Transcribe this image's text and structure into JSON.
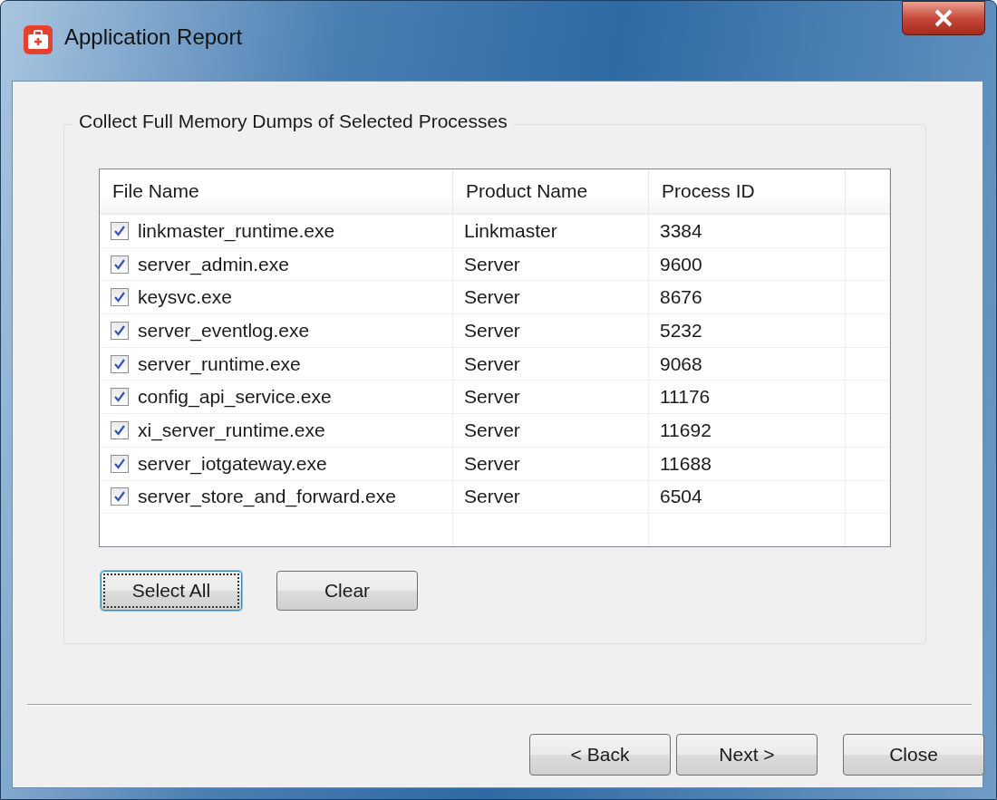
{
  "window": {
    "title": "Application Report"
  },
  "group": {
    "title": "Collect Full Memory Dumps of Selected Processes"
  },
  "table": {
    "columns": [
      "File Name",
      "Product Name",
      "Process ID"
    ],
    "rows": [
      {
        "checked": true,
        "file": "linkmaster_runtime.exe",
        "product": "Linkmaster",
        "pid": "3384"
      },
      {
        "checked": true,
        "file": "server_admin.exe",
        "product": "Server",
        "pid": "9600"
      },
      {
        "checked": true,
        "file": "keysvc.exe",
        "product": "Server",
        "pid": "8676"
      },
      {
        "checked": true,
        "file": "server_eventlog.exe",
        "product": "Server",
        "pid": "5232"
      },
      {
        "checked": true,
        "file": "server_runtime.exe",
        "product": "Server",
        "pid": "9068"
      },
      {
        "checked": true,
        "file": "config_api_service.exe",
        "product": "Server",
        "pid": "11176"
      },
      {
        "checked": true,
        "file": "xi_server_runtime.exe",
        "product": "Server",
        "pid": "11692"
      },
      {
        "checked": true,
        "file": "server_iotgateway.exe",
        "product": "Server",
        "pid": "11688"
      },
      {
        "checked": true,
        "file": "server_store_and_forward.exe",
        "product": "Server",
        "pid": "6504"
      }
    ]
  },
  "selection_buttons": [
    {
      "label": "Select All",
      "focused": true
    },
    {
      "label": "Clear",
      "focused": false
    }
  ],
  "footer_buttons": [
    {
      "label": "< Back"
    },
    {
      "label": "Next >"
    },
    {
      "label": "Close"
    }
  ]
}
